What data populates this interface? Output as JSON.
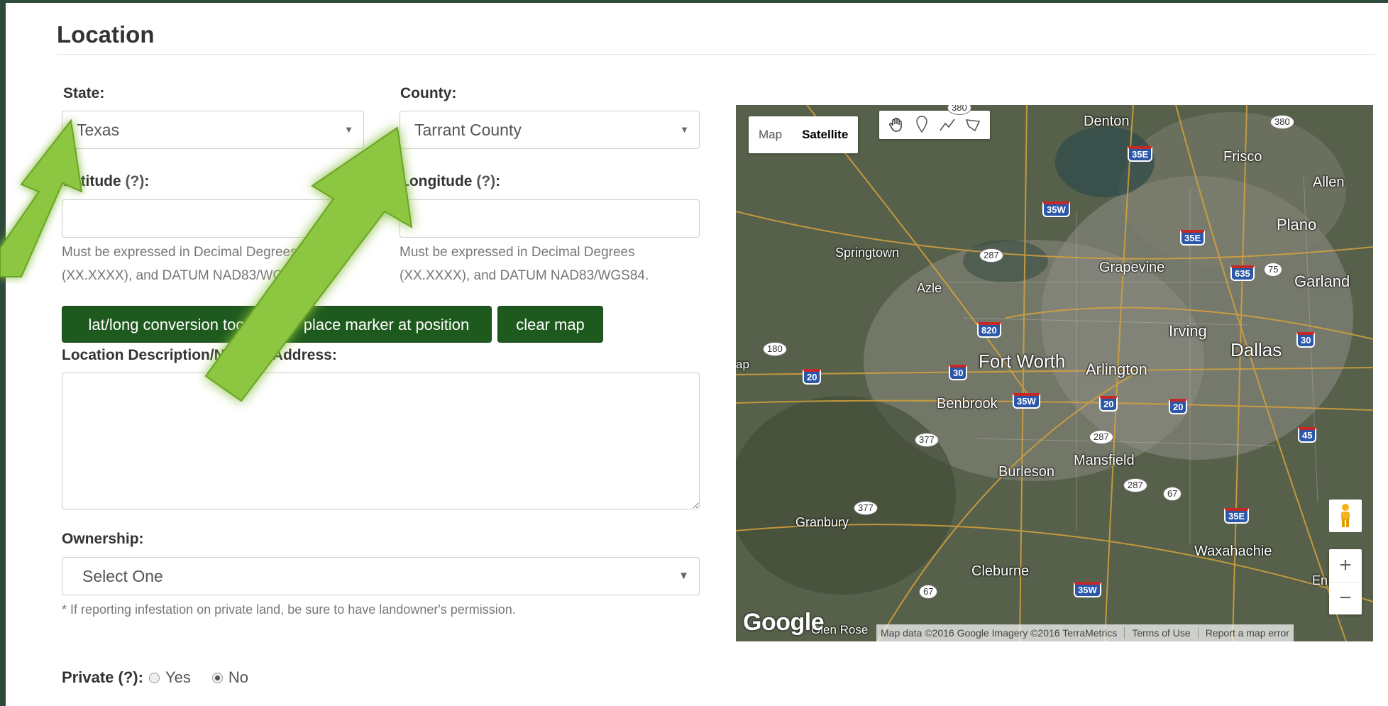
{
  "section": {
    "title": "Location"
  },
  "state": {
    "label": "State:",
    "value": "Texas"
  },
  "county": {
    "label": "County:",
    "value": "Tarrant County"
  },
  "latitude": {
    "label": "Latitude",
    "help_link": "(?)",
    "value": "",
    "help": "Must be expressed in Decimal Degrees (XX.XXXX), and DATUM NAD83/WGS84."
  },
  "longitude": {
    "label": "Longitude",
    "help_link": "(?)",
    "value": "",
    "help": "Must be expressed in Decimal Degrees (XX.XXXX), and DATUM NAD83/WGS84."
  },
  "buttons": {
    "conversion": "lat/long conversion tool",
    "place_marker": "place marker at position",
    "clear_map": "clear map"
  },
  "location_description": {
    "label": "Location Description/Nearest Address:",
    "value": ""
  },
  "ownership": {
    "label": "Ownership:",
    "value": "Select One",
    "note": "* If reporting infestation on private land, be sure to have landowner's permission."
  },
  "private": {
    "label": "Private",
    "help_link": "(?):",
    "options": [
      "Yes",
      "No"
    ],
    "selected": "No"
  },
  "map": {
    "type_controls": {
      "map": "Map",
      "satellite": "Satellite",
      "selected": "Satellite"
    },
    "draw_tools": [
      "hand-icon",
      "marker-icon",
      "polyline-icon",
      "polygon-icon"
    ],
    "cities": {
      "denton": "Denton",
      "frisco": "Frisco",
      "allen": "Allen",
      "plano": "Plano",
      "garland": "Garland",
      "springtown": "Springtown",
      "grapevine": "Grapevine",
      "azle": "Azle",
      "irving": "Irving",
      "dallas": "Dallas",
      "fort_worth": "Fort Worth",
      "arlington": "Arlington",
      "benbrook": "Benbrook",
      "mansfield": "Mansfield",
      "burleson": "Burleson",
      "granbury": "Granbury",
      "waxahachie": "Waxahachie",
      "cleburne": "Cleburne",
      "glen_rose": "Glen Rose",
      "ennis": "En",
      "ap": "ap"
    },
    "shields": {
      "i35e_a": "35E",
      "i35w_a": "35W",
      "i35e_b": "35E",
      "i635": "635",
      "i820": "820",
      "i30_a": "30",
      "i30_b": "30",
      "i20_a": "20",
      "i35w_b": "35W",
      "i20_b": "20",
      "i20_c": "20",
      "i45": "45",
      "i35e_c": "35E",
      "i35w_c": "35W"
    },
    "routes": {
      "r380_a": "380",
      "r380_b": "380",
      "r287_a": "287",
      "r75": "75",
      "r180": "180",
      "r377_a": "377",
      "r287_b": "287",
      "r287_c": "287",
      "r67_a": "67",
      "r377_b": "377",
      "r67_b": "67"
    },
    "google": "Google",
    "attribution": "Map data ©2016 Google Imagery ©2016 TerraMetrics",
    "terms": "Terms of Use",
    "report": "Report a map error",
    "zoom_in": "+",
    "zoom_out": "−"
  },
  "colors": {
    "button_bg": "#1e5a1e",
    "arrow_green": "#8dc63f",
    "page_border": "#2d4a3a"
  }
}
